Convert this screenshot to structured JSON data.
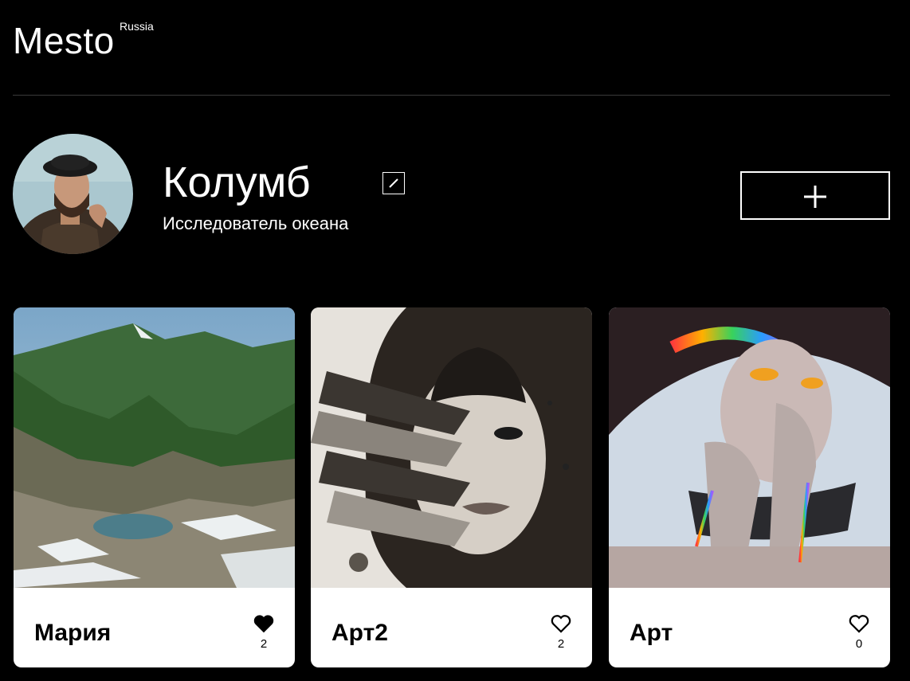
{
  "header": {
    "logo": "Mesto",
    "logo_sup": "Russia"
  },
  "profile": {
    "name": "Колумб",
    "about": "Исследователь океана",
    "avatar_icon": "portrait-avatar",
    "edit_icon": "pencil-icon",
    "add_icon": "plus-icon"
  },
  "cards": [
    {
      "title": "Мария",
      "likes": "2",
      "liked": true,
      "image": "mountain-landscape"
    },
    {
      "title": "Арт2",
      "likes": "2",
      "liked": false,
      "image": "monochrome-woman-with-feathers"
    },
    {
      "title": "Арт",
      "likes": "0",
      "liked": false,
      "image": "rainbow-cyber-woman"
    }
  ],
  "colors": {
    "background": "#000000",
    "text": "#ffffff",
    "card": "#ffffff",
    "card_text": "#000000"
  }
}
